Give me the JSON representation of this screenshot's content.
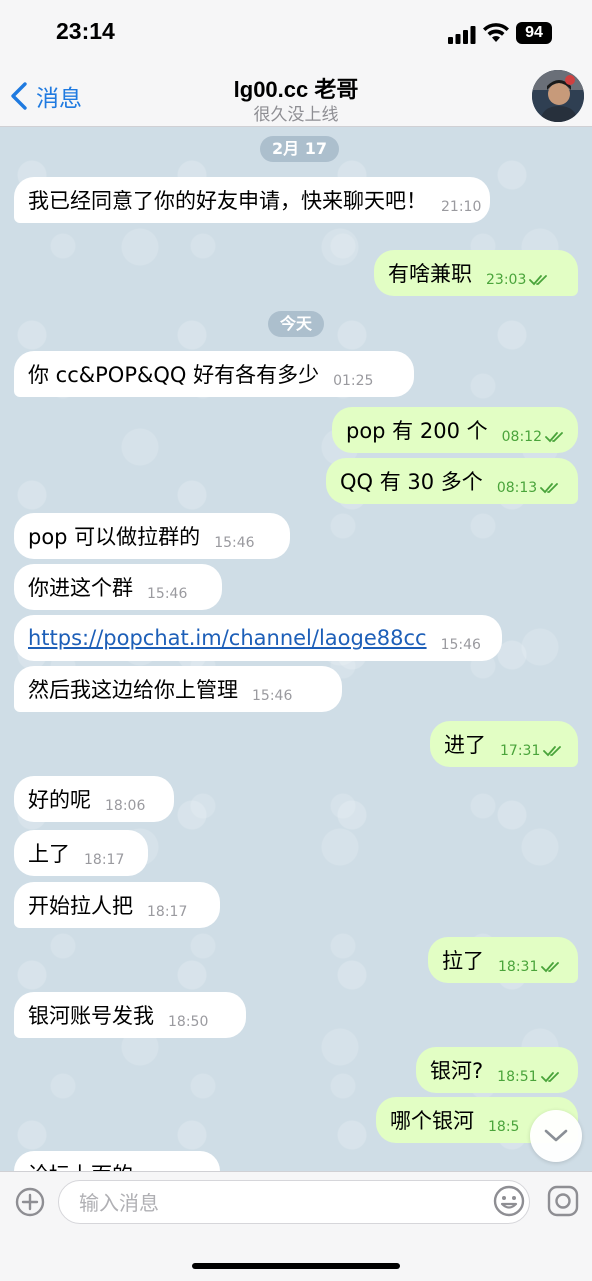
{
  "status_bar": {
    "time": "23:14",
    "battery": "94"
  },
  "header": {
    "back_label": "消息",
    "title": "lg00.cc 老哥",
    "subtitle": "很久没上线"
  },
  "dates": [
    "2月 17",
    "今天"
  ],
  "messages": [
    {
      "dir": "in",
      "text": "我已经同意了你的好友申请，快来聊天吧！",
      "time": "21:10"
    },
    {
      "dir": "out",
      "text": "有啥兼职",
      "time": "23:03"
    },
    {
      "dir": "in",
      "text": "你 cc&POP&QQ 好有各有多少",
      "time": "01:25"
    },
    {
      "dir": "out",
      "text": "pop 有 200 个",
      "time": "08:12"
    },
    {
      "dir": "out",
      "text": "QQ 有 30 多个",
      "time": "08:13"
    },
    {
      "dir": "in",
      "text": "pop 可以做拉群的",
      "time": "15:46"
    },
    {
      "dir": "in",
      "text": "你进这个群",
      "time": "15:46"
    },
    {
      "dir": "in",
      "text": "https://popchat.im/channel/laoge88cc",
      "time": "15:46",
      "link": true
    },
    {
      "dir": "in",
      "text": "然后我这边给你上管理",
      "time": "15:46"
    },
    {
      "dir": "out",
      "text": "进了",
      "time": "17:31"
    },
    {
      "dir": "in",
      "text": "好的呢",
      "time": "18:06"
    },
    {
      "dir": "in",
      "text": "上了",
      "time": "18:17"
    },
    {
      "dir": "in",
      "text": "开始拉人把",
      "time": "18:17"
    },
    {
      "dir": "out",
      "text": "拉了",
      "time": "18:31"
    },
    {
      "dir": "in",
      "text": "银河账号发我",
      "time": "18:50"
    },
    {
      "dir": "out",
      "text": "银河?",
      "time": "18:51"
    },
    {
      "dir": "out",
      "text": "哪个银河",
      "time": "18:5"
    },
    {
      "dir": "in",
      "text": "论坛上面的",
      "time": ""
    }
  ],
  "input": {
    "placeholder": "输入消息"
  },
  "colors": {
    "accent": "#1f7ae0",
    "outgoing_bubble": "#e2fec4",
    "incoming_bubble": "#ffffff",
    "chat_bg": "#cfdde6"
  },
  "icons": [
    "back-chevron-icon",
    "signal-icon",
    "wifi-icon",
    "attach-icon",
    "sticker-icon",
    "camera-icon",
    "scroll-down-icon",
    "double-check-icon"
  ]
}
